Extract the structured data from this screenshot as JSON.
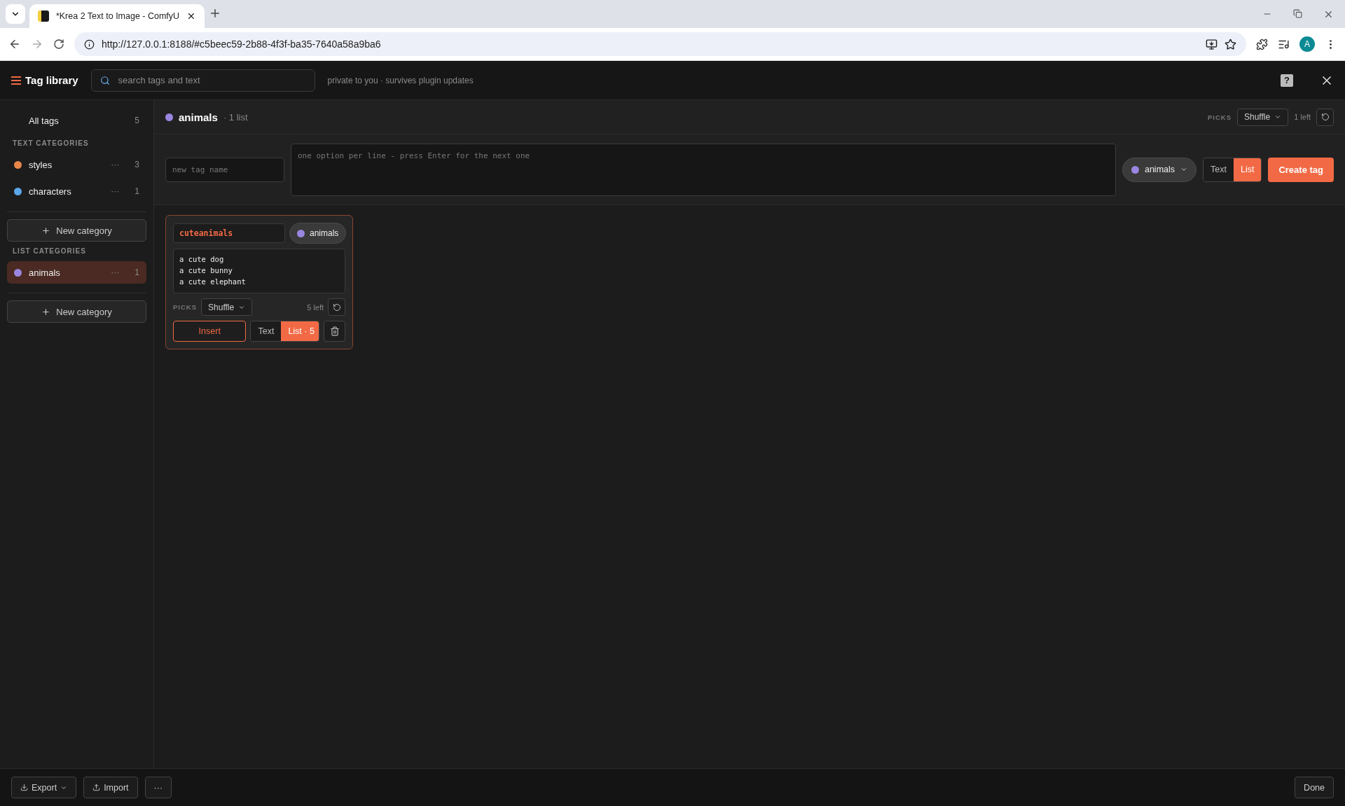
{
  "browser": {
    "tab_title": "*Krea 2 Text to Image - ComfyU",
    "url": "http://127.0.0.1:8188/#c5beec59-2b88-4f3f-ba35-7640a58a9ba6",
    "profile": "A"
  },
  "header": {
    "title": "Tag library",
    "search_placeholder": "search tags and text",
    "note": "private to you · survives plugin updates",
    "help": "?"
  },
  "sidebar": {
    "all_tags": {
      "label": "All tags",
      "count": "5",
      "selected": false
    },
    "sections": [
      {
        "heading": "TEXT CATEGORIES",
        "new_button": "New category",
        "categories": [
          {
            "name": "styles",
            "color": "#e8874a",
            "more": "···",
            "count": "3",
            "selected": false
          },
          {
            "name": "characters",
            "color": "#5aa6e8",
            "more": "···",
            "count": "1",
            "selected": false
          }
        ]
      },
      {
        "heading": "LIST CATEGORIES",
        "new_button": "New category",
        "categories": [
          {
            "name": "animals",
            "color": "#9a86e0",
            "more": "···",
            "count": "1",
            "selected": true
          }
        ]
      }
    ]
  },
  "main_header": {
    "name": "animals",
    "color": "#9a86e0",
    "meta": "· 1 list",
    "picks_label": "PICKS",
    "picks_mode": "Shuffle",
    "left": "1 left"
  },
  "creator": {
    "name_placeholder": "new tag name",
    "options_placeholder": "one option per line - press Enter for the next one",
    "category": {
      "name": "animals",
      "color": "#9a86e0"
    },
    "type_toggle": [
      {
        "label": "Text",
        "selected": false
      },
      {
        "label": "List",
        "selected": true
      }
    ],
    "create_button": "Create tag"
  },
  "cards": [
    {
      "name": "cuteanimals",
      "category": {
        "name": "animals",
        "color": "#9a86e0"
      },
      "options": "a cute dog\na cute bunny\na cute elephant",
      "picks_label": "PICKS",
      "picks_mode": "Shuffle",
      "left": "5 left",
      "insert_button": "Insert",
      "type_toggle": [
        {
          "label": "Text",
          "selected": false
        },
        {
          "label": "List · 5",
          "selected": true
        }
      ]
    }
  ],
  "footer": {
    "buttons": [
      {
        "label": "Export",
        "kind": "export"
      },
      {
        "label": "Import",
        "kind": "import"
      },
      {
        "label": "···",
        "kind": "more"
      }
    ],
    "done_button": "Done"
  }
}
